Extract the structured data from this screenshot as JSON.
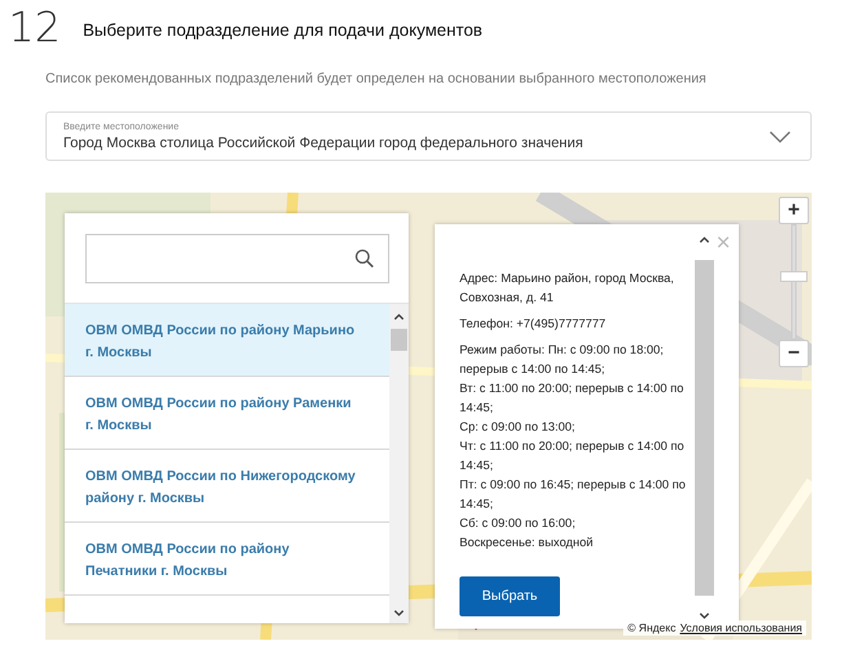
{
  "step": {
    "number": "12",
    "title": "Выберите подразделение для подачи документов"
  },
  "hint": "Список рекомендованных подразделений будет определен на основании выбранного местоположения",
  "location_field": {
    "label": "Введите местоположение",
    "value": "Город Москва столица Российской Федерации город федерального значения"
  },
  "map": {
    "kind": "picture",
    "attribution": "© Яндекс",
    "terms_link": "Условия использования",
    "zoom_in": "+",
    "zoom_out": "−",
    "zoom_slider": {
      "level": 0.55
    }
  },
  "office_list": {
    "items": [
      {
        "name": "ОВМ ОМВД России по району Марьино г. Москвы",
        "selected": true
      },
      {
        "name": "ОВМ ОМВД России по району Раменки г. Москвы",
        "selected": false
      },
      {
        "name": "ОВМ ОМВД России по Нижегородскому району г. Москвы",
        "selected": false
      },
      {
        "name": "ОВМ ОМВД России по району Печатники г. Москвы",
        "selected": false
      }
    ]
  },
  "office_details": {
    "address": "Адрес: Марьино район, город Москва, Совхозная, д. 41",
    "phone": "Телефон: +7(495)7777777",
    "hours": [
      "Режим работы: Пн: с 09:00 по 18:00; перерыв с 14:00 по 14:45;",
      "Вт: с 11:00 по 20:00; перерыв с 14:00 по 14:45;",
      "Ср: с 09:00 по 13:00;",
      "Чт: с 11:00 по 20:00; перерыв с 14:00 по 14:45;",
      "Пт: с 09:00 по 16:45; перерыв с 14:00 по 14:45;",
      "Сб: с 09:00 по 16:00;",
      "Воскресенье: выходной"
    ],
    "close": "×",
    "select_button": "Выбрать"
  }
}
